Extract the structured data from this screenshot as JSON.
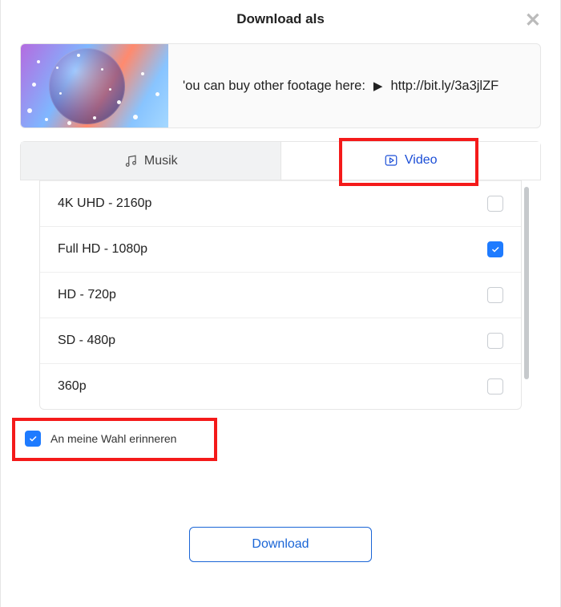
{
  "header": {
    "title": "Download als"
  },
  "info": {
    "text_left": "'ou can buy other footage here:",
    "link": "http://bit.ly/3a3jlZF"
  },
  "tabs": {
    "music": {
      "label": "Musik",
      "active": false
    },
    "video": {
      "label": "Video",
      "active": true
    }
  },
  "options": [
    {
      "label": "4K UHD - 2160p",
      "checked": false
    },
    {
      "label": "Full HD - 1080p",
      "checked": true
    },
    {
      "label": "HD - 720p",
      "checked": false
    },
    {
      "label": "SD - 480p",
      "checked": false
    },
    {
      "label": "360p",
      "checked": false
    }
  ],
  "remember": {
    "label": "An meine Wahl erinneren",
    "checked": true
  },
  "download_button": "Download",
  "colors": {
    "accent": "#1e7bff",
    "link_blue": "#1a65d6",
    "highlight": "#f41a1a"
  }
}
